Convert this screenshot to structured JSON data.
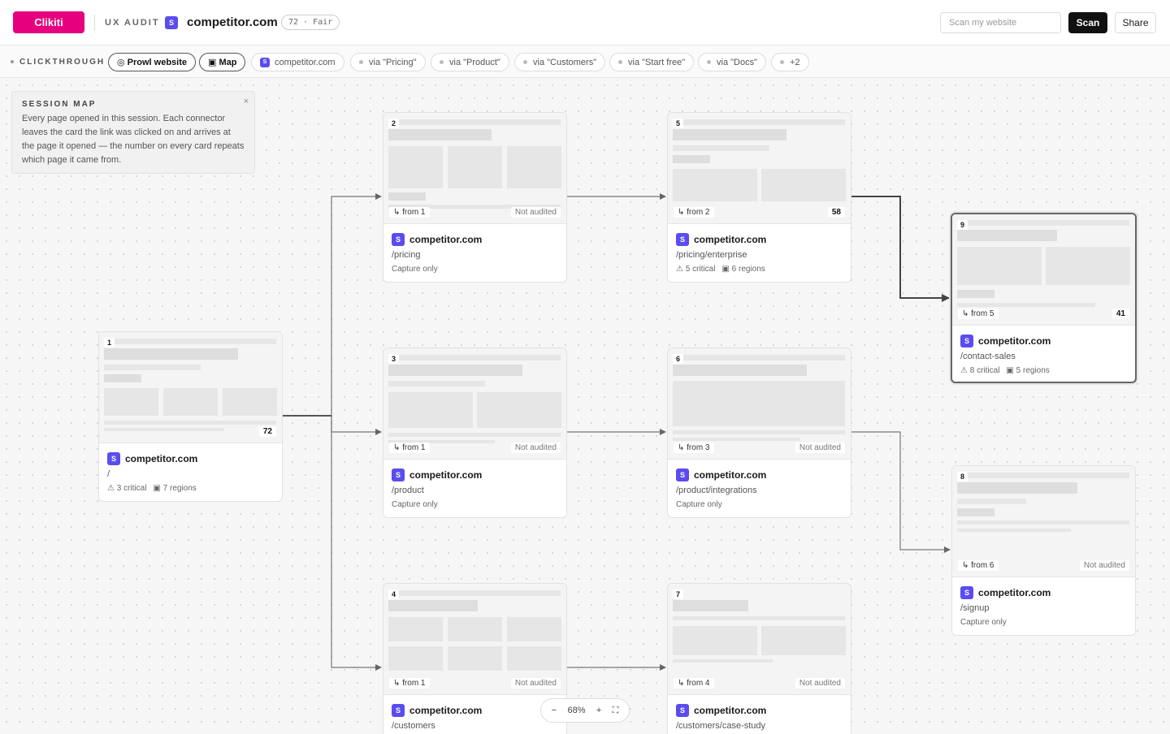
{
  "header": {
    "brand": "Clikiti",
    "section": "UX AUDIT",
    "site_icon": "S",
    "domain": "competitor.com",
    "score_badge": "72 · Fair",
    "scan_placeholder": "Scan my website",
    "scan_label": "Scan",
    "share_label": "Share"
  },
  "crumbs": {
    "label": "CLICKTHROUGH",
    "prowl": "◎ Prowl website",
    "map": "▣ Map",
    "root": "competitor.com",
    "via": [
      "via \"Pricing\"",
      "via \"Product\"",
      "via \"Customers\"",
      "via \"Start free\"",
      "via \"Docs\""
    ],
    "more": "+2"
  },
  "note": {
    "title": "SESSION MAP",
    "body": "Every page opened in this session. Each connector leaves the card the link was clicked on and arrives at the page it opened — the number on every card repeats which page it came from.",
    "close": "×"
  },
  "cards": [
    {
      "num": "1",
      "from": "",
      "status": "72",
      "domain": "competitor.com",
      "path": "/",
      "critical": "⚠ 3 critical",
      "regions": "▣ 7 regions",
      "capture": ""
    },
    {
      "num": "2",
      "from": "↳ from 1",
      "status": "Not audited",
      "domain": "competitor.com",
      "path": "/pricing",
      "critical": "",
      "regions": "",
      "capture": "Capture only"
    },
    {
      "num": "3",
      "from": "↳ from 1",
      "status": "Not audited",
      "domain": "competitor.com",
      "path": "/product",
      "critical": "",
      "regions": "",
      "capture": "Capture only"
    },
    {
      "num": "4",
      "from": "↳ from 1",
      "status": "Not audited",
      "domain": "competitor.com",
      "path": "/customers",
      "critical": "",
      "regions": "",
      "capture": ""
    },
    {
      "num": "5",
      "from": "↳ from 2",
      "status": "58",
      "domain": "competitor.com",
      "path": "/pricing/enterprise",
      "critical": "⚠ 5 critical",
      "regions": "▣ 6 regions",
      "capture": ""
    },
    {
      "num": "6",
      "from": "↳ from 3",
      "status": "Not audited",
      "domain": "competitor.com",
      "path": "/product/integrations",
      "critical": "",
      "regions": "",
      "capture": "Capture only"
    },
    {
      "num": "7",
      "from": "↳ from 4",
      "status": "Not audited",
      "domain": "competitor.com",
      "path": "/customers/case-study",
      "critical": "",
      "regions": "",
      "capture": ""
    },
    {
      "num": "8",
      "from": "↳ from 6",
      "status": "Not audited",
      "domain": "competitor.com",
      "path": "/signup",
      "critical": "",
      "regions": "",
      "capture": "Capture only"
    },
    {
      "num": "9",
      "from": "↳ from 5",
      "status": "41",
      "domain": "competitor.com",
      "path": "/contact-sales",
      "critical": "⚠ 8 critical",
      "regions": "▣ 5 regions",
      "capture": ""
    }
  ],
  "zoom": {
    "minus": "−",
    "level": "68%",
    "plus": "+",
    "fit": "⛶"
  }
}
